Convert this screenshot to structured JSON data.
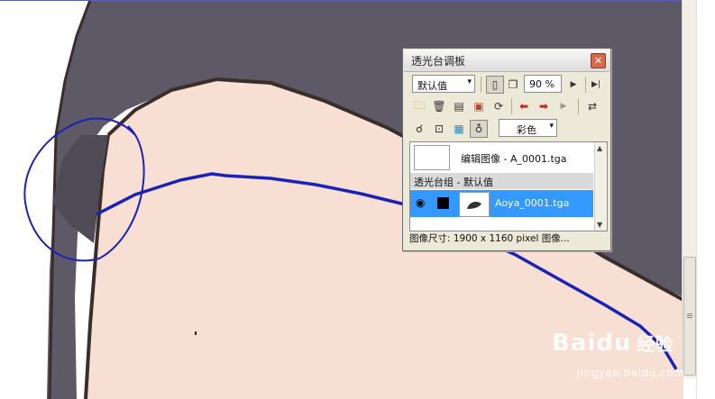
{
  "palette": {
    "title": "透光台调板",
    "preset_value": "默认值",
    "zoom_value": "90 %",
    "color_mode": "彩色",
    "edit_layer_label": "编辑图像 - A_0001.tga",
    "group_label": "透光台组 - 默认值",
    "selected_layer_label": "Aoya_0001.tga",
    "status_text": "图像尺寸: 1900 x 1160 pixel 图像..."
  },
  "watermark": {
    "brand": "Baidu",
    "product": "经验",
    "url": "jingyan.baidu.com"
  },
  "colors": {
    "skin": "#f7dfd4",
    "hair": "#5d5966",
    "outline": "#3b2e2a",
    "annotation": "#1a22b8",
    "selection": "#3399ff"
  }
}
